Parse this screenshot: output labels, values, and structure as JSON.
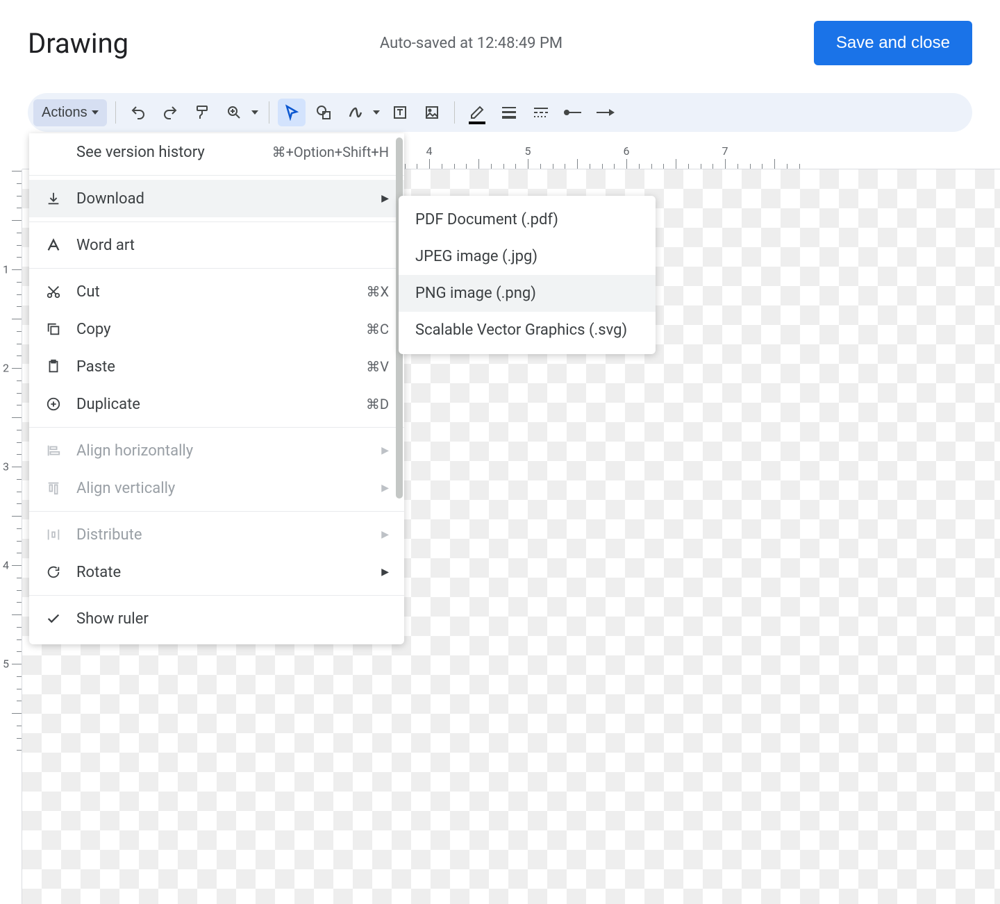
{
  "header": {
    "title": "Drawing",
    "autosave": "Auto-saved at 12:48:49 PM",
    "save_button": "Save and close"
  },
  "toolbar": {
    "actions_label": "Actions"
  },
  "menu": {
    "version_history": {
      "label": "See version history",
      "shortcut": "⌘+Option+Shift+H"
    },
    "download": {
      "label": "Download"
    },
    "word_art": {
      "label": "Word art"
    },
    "cut": {
      "label": "Cut",
      "shortcut": "⌘X"
    },
    "copy": {
      "label": "Copy",
      "shortcut": "⌘C"
    },
    "paste": {
      "label": "Paste",
      "shortcut": "⌘V"
    },
    "duplicate": {
      "label": "Duplicate",
      "shortcut": "⌘D"
    },
    "align_h": {
      "label": "Align horizontally"
    },
    "align_v": {
      "label": "Align vertically"
    },
    "distribute": {
      "label": "Distribute"
    },
    "rotate": {
      "label": "Rotate"
    },
    "show_ruler": {
      "label": "Show ruler"
    }
  },
  "submenu": {
    "pdf": "PDF Document (.pdf)",
    "jpeg": "JPEG image (.jpg)",
    "png": "PNG image (.png)",
    "svg": "Scalable Vector Graphics (.svg)"
  },
  "ruler": {
    "h_labels": [
      "4",
      "5",
      "6",
      "7"
    ],
    "h_positions": [
      586,
      728,
      870,
      1012
    ],
    "v_labels": [
      "1",
      "2",
      "3",
      "4",
      "5"
    ],
    "v_positions": [
      144,
      286,
      428,
      570,
      712
    ]
  }
}
